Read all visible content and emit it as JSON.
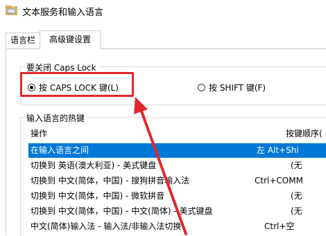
{
  "window": {
    "title": "文本服务和输入语言"
  },
  "tabs": [
    {
      "label": "语言栏"
    },
    {
      "label": "高级键设置"
    }
  ],
  "caps_lock_group": {
    "title": "要关闭 Caps Lock",
    "option_caps": "按 CAPS LOCK 键(L)",
    "option_shift": "按 SHIFT 键(F)",
    "selected": "caps"
  },
  "hotkeys_group": {
    "title": "输入语言的热键",
    "columns": {
      "action": "操作",
      "keys": "按键顺序("
    },
    "rows": [
      {
        "action": "在输入语言之间",
        "keys": "左 Alt+Shi",
        "selected": true
      },
      {
        "action": "切换到 英语(澳大利亚) - 美式键盘",
        "keys": "(无",
        "selected": false
      },
      {
        "action": "切换到 中文(简体，中国) - 搜狗拼音输入法",
        "keys": "Ctrl+COMM",
        "selected": false
      },
      {
        "action": "切换到 中文(简体，中国) - 微软拼音",
        "keys": "(无",
        "selected": false
      },
      {
        "action": "切换到 中文(简体，中国) - 中文(简体) - 美式键盘",
        "keys": "(无",
        "selected": false
      },
      {
        "action": "中文(简体)输入法 - 输入法/非输入法切换",
        "keys": "Ctrl+空",
        "selected": false
      }
    ]
  },
  "colors": {
    "highlight_box": "#e3262b",
    "arrow": "#e3262b",
    "selection": "#0078d7"
  }
}
